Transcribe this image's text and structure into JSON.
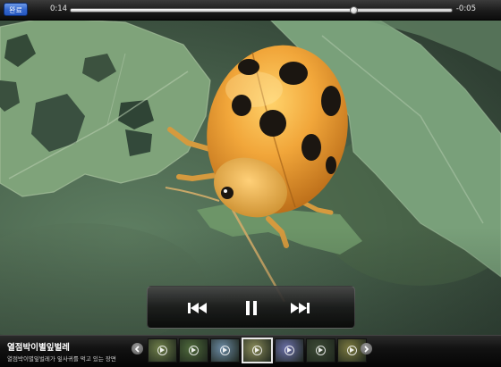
{
  "player": {
    "done_label": "완료",
    "time_elapsed": "0:14",
    "time_remaining": "-0:05",
    "progress": 0.74
  },
  "controls": {
    "previous_icon": "skip-previous-icon",
    "pause_icon": "pause-icon",
    "next_icon": "skip-next-icon"
  },
  "clip": {
    "title": "열점박이별잎벌레",
    "subtitle": "열점박이별잎벌레가 잎사귀를 먹고 있는 장면"
  },
  "thumbnails": {
    "count": 7,
    "active_index": 3,
    "colors": [
      "#6f7f4a",
      "#4f6a3c",
      "#6b8aa3",
      "#8a8b5a",
      "#6a6fa8",
      "#3d4a36",
      "#7c7a40"
    ]
  },
  "colors": {
    "done_button": "#3568cf",
    "bar_background": "#121212",
    "scrub_track": "#d8d8d8"
  }
}
